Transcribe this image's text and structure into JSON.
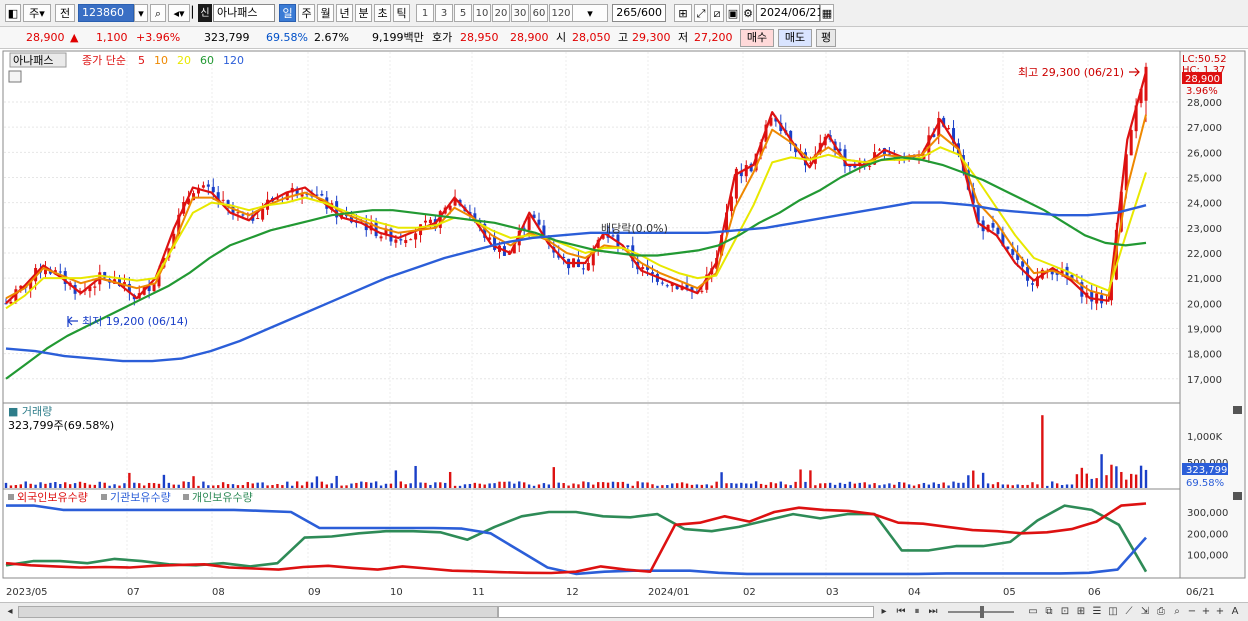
{
  "toolbar": {
    "market_label": "주",
    "prev_label": "전",
    "code_value": "123860",
    "stock_flag": "신",
    "stock_name": "아나패스",
    "period_tabs": [
      "일",
      "주",
      "월",
      "년",
      "분",
      "초",
      "틱"
    ],
    "interval_buttons": [
      "1",
      "3",
      "5",
      "10",
      "20",
      "30",
      "60",
      "120"
    ],
    "count_value": "265",
    "count_total": "/600",
    "date_value": "2024/06/21"
  },
  "quote": {
    "price": "28,900",
    "change_arrow": "▲",
    "change": "1,100",
    "change_pct": "+3.96%",
    "volume": "323,799",
    "volume_ratio": "69.58%",
    "turnover": "2.67%",
    "amount": "9,199백만",
    "bid_label": "호가",
    "bid1": "28,950",
    "bid2": "28,900",
    "open_label": "시",
    "open": "28,050",
    "high_label": "고",
    "high": "29,300",
    "low_label": "저",
    "low": "27,200",
    "buy_label": "매수",
    "sell_label": "매도",
    "eval_label": "평"
  },
  "price_panel": {
    "stock_tag": "아나패스",
    "ma_title": "종가 단순",
    "ma_periods": [
      "5",
      "10",
      "20",
      "60",
      "120"
    ],
    "ma_colors": [
      "#dd1111",
      "#ee8800",
      "#e8e800",
      "#229933",
      "#2b5ed8"
    ],
    "high_annotation": "최고 29,300 (06/21)",
    "low_annotation": "최저 19,200 (06/14)",
    "dividend_annotation": "배당락(0.0%)",
    "current_price": "28,900",
    "current_pct": "3.96%",
    "lc_label": "LC:50.52",
    "hc_label": "HC: 1.37",
    "y_ticks": [
      "28,000",
      "27,000",
      "26,000",
      "25,000",
      "24,000",
      "23,000",
      "22,000",
      "21,000",
      "20,000",
      "19,000",
      "18,000",
      "17,000"
    ]
  },
  "volume_panel": {
    "title": "거래량",
    "value_text": "323,799주(69.58%)",
    "current": "323,799",
    "current_pct": "69.58%",
    "y_ticks": [
      "1,000K",
      "500,000"
    ]
  },
  "holding_panel": {
    "series": [
      "외국인보유수량",
      "기관보유수량",
      "개인보유수량"
    ],
    "series_colors": [
      "#dd1111",
      "#2b5ed8",
      "#2e8b57"
    ],
    "y_ticks": [
      "300,000",
      "200,000",
      "100,000"
    ]
  },
  "x_axis": [
    "2023/05",
    "07",
    "08",
    "09",
    "10",
    "11",
    "12",
    "2024/01",
    "02",
    "03",
    "04",
    "05",
    "06",
    "06/21"
  ],
  "colors": {
    "up": "#dd1111",
    "down": "#1a3fc8",
    "accent": "#3a7bd5"
  },
  "chart_data": {
    "type": "candlestick",
    "series": [
      {
        "name": "5",
        "values": [
          20000,
          20700,
          21500,
          21000,
          20400,
          21000,
          20800,
          20200,
          21000,
          23000,
          24600,
          24400,
          23600,
          23300,
          24000,
          24400,
          24600,
          24000,
          23400,
          23200,
          22800,
          22600,
          22900,
          23200,
          24200,
          23400,
          22300,
          22000,
          23600,
          22400,
          21600,
          21600,
          22800,
          22300,
          21300,
          21000,
          20700,
          20400,
          21600,
          25100,
          25500,
          27600,
          26500,
          25400,
          26700,
          25500,
          25500,
          26100,
          25800,
          25900,
          27300,
          26100,
          23200,
          22700,
          21600,
          20900,
          21400,
          20900,
          20200,
          20100,
          26500,
          29200
        ]
      },
      {
        "name": "10",
        "values": [
          20200,
          20600,
          21400,
          21100,
          20800,
          21000,
          20800,
          20600,
          20800,
          22400,
          24200,
          24200,
          23800,
          23500,
          23900,
          24200,
          24400,
          24100,
          23600,
          23300,
          23000,
          22800,
          22900,
          23000,
          23800,
          23400,
          22700,
          22300,
          22800,
          22500,
          22000,
          21800,
          22300,
          22200,
          21600,
          21200,
          20900,
          20600,
          21200,
          23800,
          25200,
          26900,
          26400,
          25700,
          26200,
          25700,
          25600,
          25900,
          25800,
          25900,
          26700,
          26100,
          24000,
          23200,
          22100,
          21200,
          21300,
          21000,
          20500,
          20300,
          24600,
          27500
        ]
      },
      {
        "name": "20",
        "values": [
          19800,
          20300,
          21000,
          21000,
          21000,
          21100,
          21000,
          20900,
          21000,
          22300,
          23600,
          24000,
          23900,
          23700,
          23900,
          24000,
          24200,
          24000,
          23700,
          23400,
          23200,
          23000,
          23000,
          23100,
          23400,
          23300,
          22900,
          22600,
          22700,
          22600,
          22300,
          22000,
          22200,
          22200,
          21900,
          21500,
          21200,
          21000,
          21100,
          22500,
          23900,
          25600,
          25800,
          25700,
          25900,
          25700,
          25600,
          25700,
          25700,
          25800,
          26200,
          25900,
          24900,
          23800,
          22700,
          21800,
          21500,
          21200,
          20800,
          20500,
          22900,
          25200
        ]
      },
      {
        "name": "60",
        "values": [
          17000,
          17600,
          18200,
          18700,
          19100,
          19500,
          19900,
          20300,
          20700,
          21200,
          21800,
          22300,
          22600,
          22900,
          23100,
          23300,
          23500,
          23600,
          23700,
          23700,
          23600,
          23500,
          23400,
          23300,
          23200,
          23000,
          22800,
          22500,
          22300,
          22100,
          22000,
          21900,
          21900,
          22000,
          22100,
          22300,
          22700,
          23200,
          23600,
          24100,
          24500,
          25000,
          25400,
          25700,
          25800,
          25700,
          25500,
          25200,
          24900,
          24500,
          24100,
          23700,
          23200,
          22700,
          22400,
          22300,
          22400
        ]
      },
      {
        "name": "120",
        "values": [
          18200,
          18100,
          17900,
          17800,
          17700,
          17700,
          17800,
          18100,
          18500,
          19000,
          19500,
          20000,
          20500,
          21000,
          21400,
          21800,
          22100,
          22400,
          22600,
          22700,
          22800,
          22800,
          22800,
          22800,
          22800,
          22900,
          23000,
          23200,
          23400,
          23600,
          23800,
          24000,
          24000,
          23900,
          23700,
          23600,
          23500,
          23500,
          23600,
          23900
        ]
      }
    ],
    "x": [
      "2023/05",
      "07",
      "08",
      "09",
      "10",
      "11",
      "12",
      "2024/01",
      "02",
      "03",
      "04",
      "05",
      "06",
      "06/21"
    ],
    "ylim": [
      16500,
      29500
    ]
  }
}
